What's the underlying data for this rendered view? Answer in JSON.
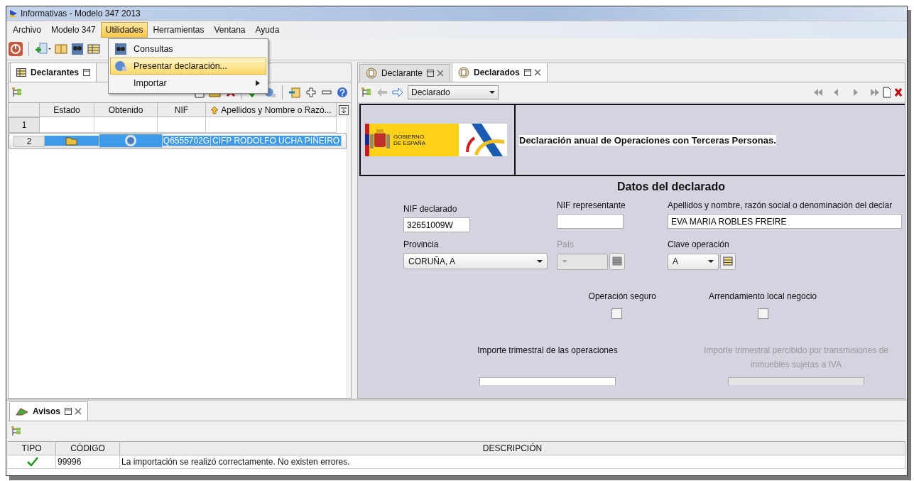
{
  "window": {
    "title": "Informativas - Modelo 347 2013"
  },
  "menu": [
    {
      "label": "Archivo",
      "selected": false
    },
    {
      "label": "Modelo 347",
      "selected": false
    },
    {
      "label": "Utilidades",
      "selected": true
    },
    {
      "label": "Herramientas",
      "selected": false
    },
    {
      "label": "Ventana",
      "selected": false
    },
    {
      "label": "Ayuda",
      "selected": false
    }
  ],
  "open_menu": {
    "items": [
      {
        "label": "Consultas",
        "selected": false,
        "submenu": false
      },
      {
        "label": "Presentar declaración...",
        "selected": true,
        "submenu": false
      },
      {
        "label": "Importar",
        "selected": false,
        "submenu": true
      }
    ]
  },
  "left_panel": {
    "tab": "Declarantes",
    "table": {
      "columns": [
        "Estado",
        "Obtenido",
        "NIF",
        "Apellidos y Nombre o Razó..."
      ],
      "rows": [
        {
          "number": "1",
          "selected": false,
          "icons": false
        },
        {
          "number": "2",
          "selected": true,
          "icons": true,
          "nif": "Q6555702G",
          "name": "CIFP RODOLFO UCHA PIÑEIRO"
        }
      ]
    }
  },
  "right_panel": {
    "tabs": [
      {
        "label": "Declarante",
        "selected": false
      },
      {
        "label": "Declarados",
        "selected": true
      }
    ],
    "selector": {
      "value": "Declarado"
    },
    "banner": {
      "logo_lines": [
        "GOBIERNO",
        "DE ESPAÑA"
      ],
      "heading": "Declaración anual de Operaciones con Terceras Personas."
    },
    "form": {
      "title": "Datos del declarado",
      "text_fields": [
        {
          "label": "NIF declarado",
          "value": "32651009W",
          "kind": "short"
        },
        {
          "label": "NIF representante",
          "kind": "short"
        },
        {
          "label": "Apellidos y nombre,  razón social o denominación del declar",
          "value": "EVA MARIA ROBLES FREIRE",
          "kind": "long"
        }
      ],
      "selects": [
        {
          "label": "Provincia",
          "value": "CORUÑA, A",
          "disabled": false,
          "kind": "wide"
        },
        {
          "label": "País",
          "disabled": true,
          "kind": "table"
        },
        {
          "label": "Clave operación",
          "value": "A",
          "disabled": false,
          "kind": "table"
        }
      ],
      "checkboxes": [
        {
          "label": "Operación seguro",
          "checked": false
        },
        {
          "label": "Arrendamiento local negocio",
          "checked": false
        }
      ],
      "amounts": [
        {
          "label": "Importe trimestral de las operaciones",
          "disabled": false
        },
        {
          "label": "Importe trimestral percibido por transmisiones de inmuebles sujetas a IVA",
          "disabled": true
        }
      ]
    }
  },
  "avisos": {
    "tab": "Avisos",
    "columns": [
      "TIPO",
      "CÓDIGO",
      "DESCRIPCIÓN"
    ],
    "rows": [
      {
        "ok": true,
        "code": "99996",
        "description": "La importación se realizó correctamente. No existen errores."
      }
    ]
  }
}
